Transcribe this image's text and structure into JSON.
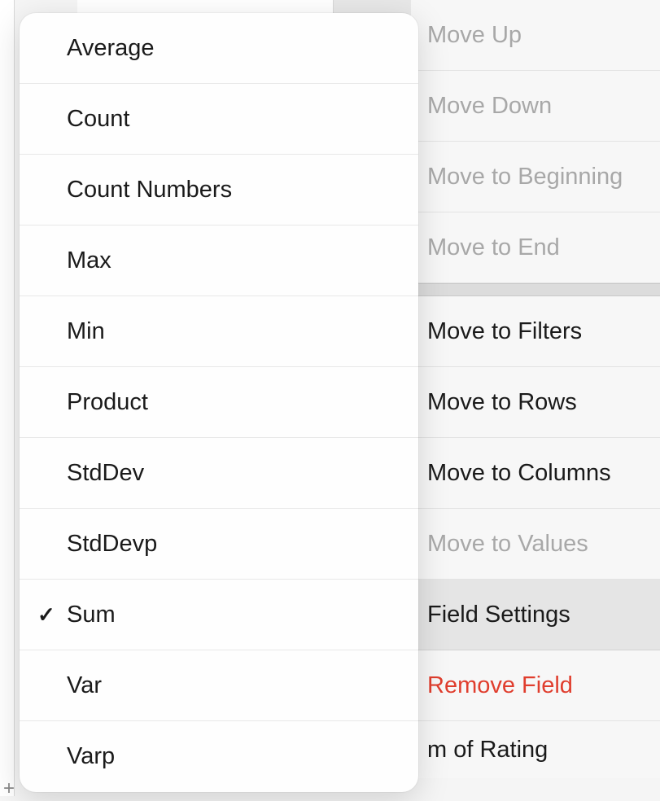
{
  "context_menu": {
    "items": [
      {
        "label": "Move Up",
        "state": "disabled"
      },
      {
        "label": "Move Down",
        "state": "disabled"
      },
      {
        "label": "Move to Beginning",
        "state": "disabled"
      },
      {
        "label": "Move to End",
        "state": "disabled"
      }
    ],
    "items2": [
      {
        "label": "Move to Filters",
        "state": "normal"
      },
      {
        "label": "Move to Rows",
        "state": "normal"
      },
      {
        "label": "Move to Columns",
        "state": "normal"
      },
      {
        "label": "Move to Values",
        "state": "disabled"
      },
      {
        "label": "Field Settings",
        "state": "highlighted"
      },
      {
        "label": "Remove Field",
        "state": "danger"
      }
    ],
    "footer": "m of Rating"
  },
  "aggregation_menu": {
    "items": [
      {
        "label": "Average",
        "checked": false
      },
      {
        "label": "Count",
        "checked": false
      },
      {
        "label": "Count Numbers",
        "checked": false
      },
      {
        "label": "Max",
        "checked": false
      },
      {
        "label": "Min",
        "checked": false
      },
      {
        "label": "Product",
        "checked": false
      },
      {
        "label": "StdDev",
        "checked": false
      },
      {
        "label": "StdDevp",
        "checked": false
      },
      {
        "label": "Sum",
        "checked": true
      },
      {
        "label": "Var",
        "checked": false
      },
      {
        "label": "Varp",
        "checked": false
      }
    ]
  },
  "ui": {
    "checkmark": "✓",
    "plus": "+"
  }
}
